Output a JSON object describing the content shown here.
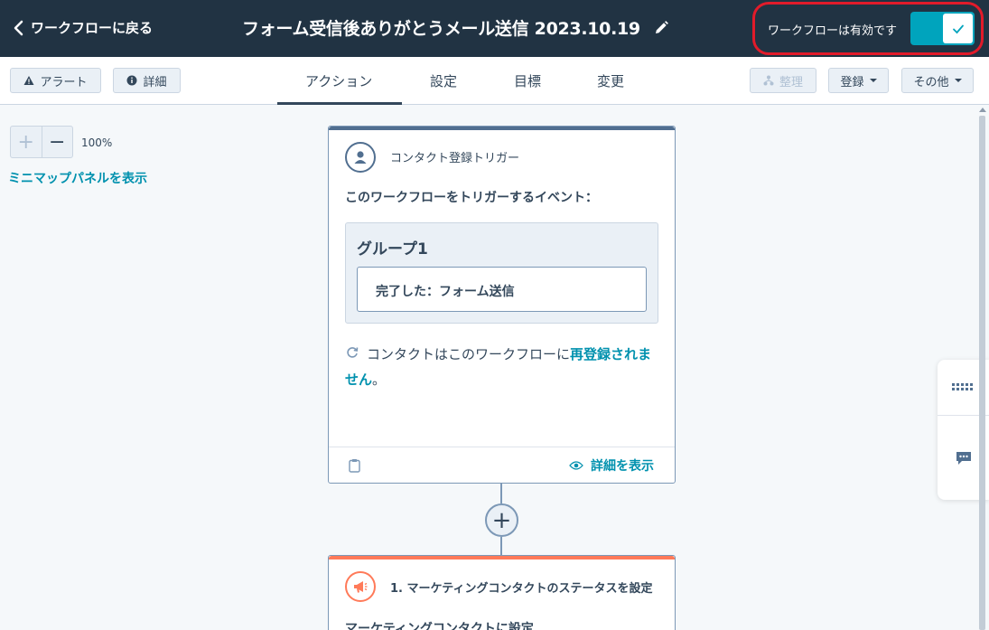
{
  "header": {
    "back_label": "ワークフローに戻る",
    "title": "フォーム受信後ありがとうメール送信 2023.10.19",
    "status_text": "ワークフローは有効です",
    "toggle_on": true
  },
  "toolbar": {
    "alert_label": "アラート",
    "details_label": "詳細",
    "tabs": [
      "アクション",
      "設定",
      "目標",
      "変更"
    ],
    "active_tab": "アクション",
    "organize_label": "整理",
    "register_label": "登録",
    "more_label": "その他"
  },
  "canvas": {
    "zoom_in": "+",
    "zoom_out": "−",
    "zoom_level": "100%",
    "minimap_label": "ミニマップパネルを表示"
  },
  "trigger_card": {
    "heading": "コンタクト登録トリガー",
    "subheading": "このワークフローをトリガーするイベント：",
    "group_title": "グループ1",
    "condition": "完了した：フォーム送信",
    "reenroll_prefix": "コンタクトはこのワークフローに",
    "reenroll_link": "再登録されません",
    "reenroll_suffix": "。",
    "view_details": "詳細を表示"
  },
  "action_card": {
    "heading": "1. マーケティングコンタクトのステータスを設定",
    "body": "マーケティングコンタクトに設定"
  },
  "colors": {
    "header_bg": "#213343",
    "accent": "#00a4bd",
    "link": "#0091ae",
    "highlight_ring": "#e21b2a",
    "action_accent": "#ff7a59"
  }
}
